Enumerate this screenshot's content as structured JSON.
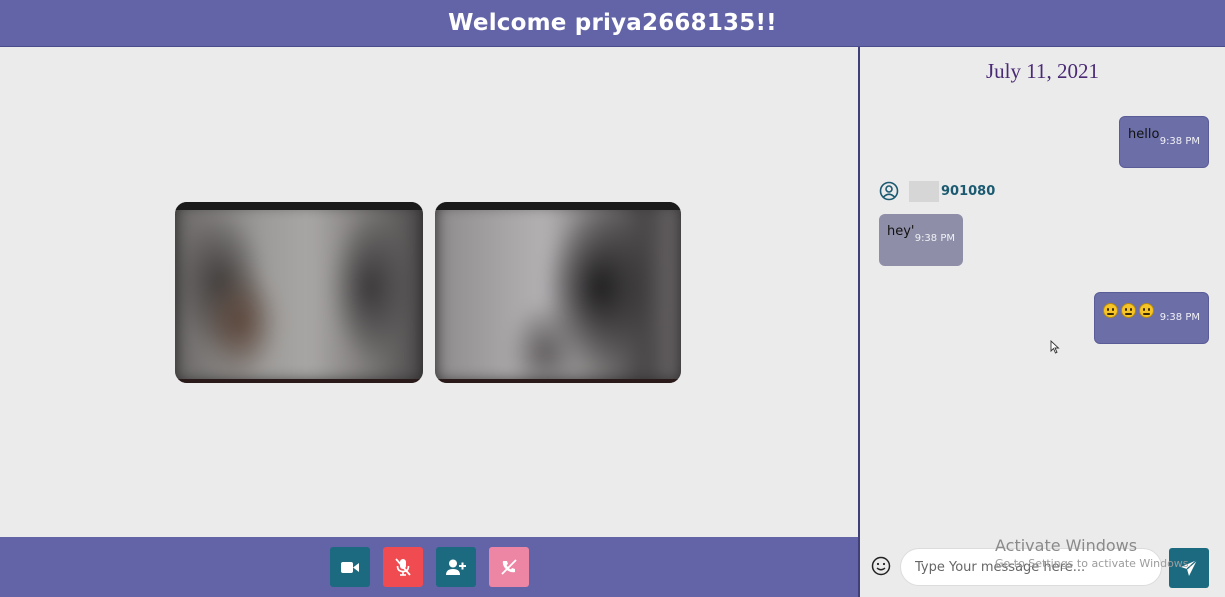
{
  "header": {
    "title": "Welcome priya2668135!!"
  },
  "video": {
    "tiles": [
      {
        "name": "local-video"
      },
      {
        "name": "remote-video"
      }
    ]
  },
  "controls": {
    "items": [
      {
        "id": "video",
        "icon": "video-camera-icon",
        "color": "#1b6a80"
      },
      {
        "id": "mic",
        "icon": "mic-off-icon",
        "color": "#ef4b50"
      },
      {
        "id": "add-user",
        "icon": "add-user-icon",
        "color": "#1b6a80"
      },
      {
        "id": "hangup",
        "icon": "phone-off-icon",
        "color": "#ed86a4"
      }
    ]
  },
  "chat": {
    "date": "July 11, 2021",
    "messages": [
      {
        "from": "me",
        "text": "hello",
        "time": "9:38 PM"
      },
      {
        "from": "other",
        "sender": "901080",
        "text": "hey'",
        "time": "9:38 PM"
      },
      {
        "from": "me",
        "text": "",
        "emoji_count": 3,
        "time": "9:38 PM"
      }
    ],
    "input": {
      "placeholder": "Type Your message here..."
    }
  },
  "watermark": {
    "line1": "Activate Windows",
    "line2": "Go to Settings to activate Windows."
  },
  "colors": {
    "brand": "#6264a7",
    "accent": "#1b6a80",
    "danger": "#ef4b50",
    "hangup": "#ed86a4",
    "date": "#4a2a74"
  }
}
